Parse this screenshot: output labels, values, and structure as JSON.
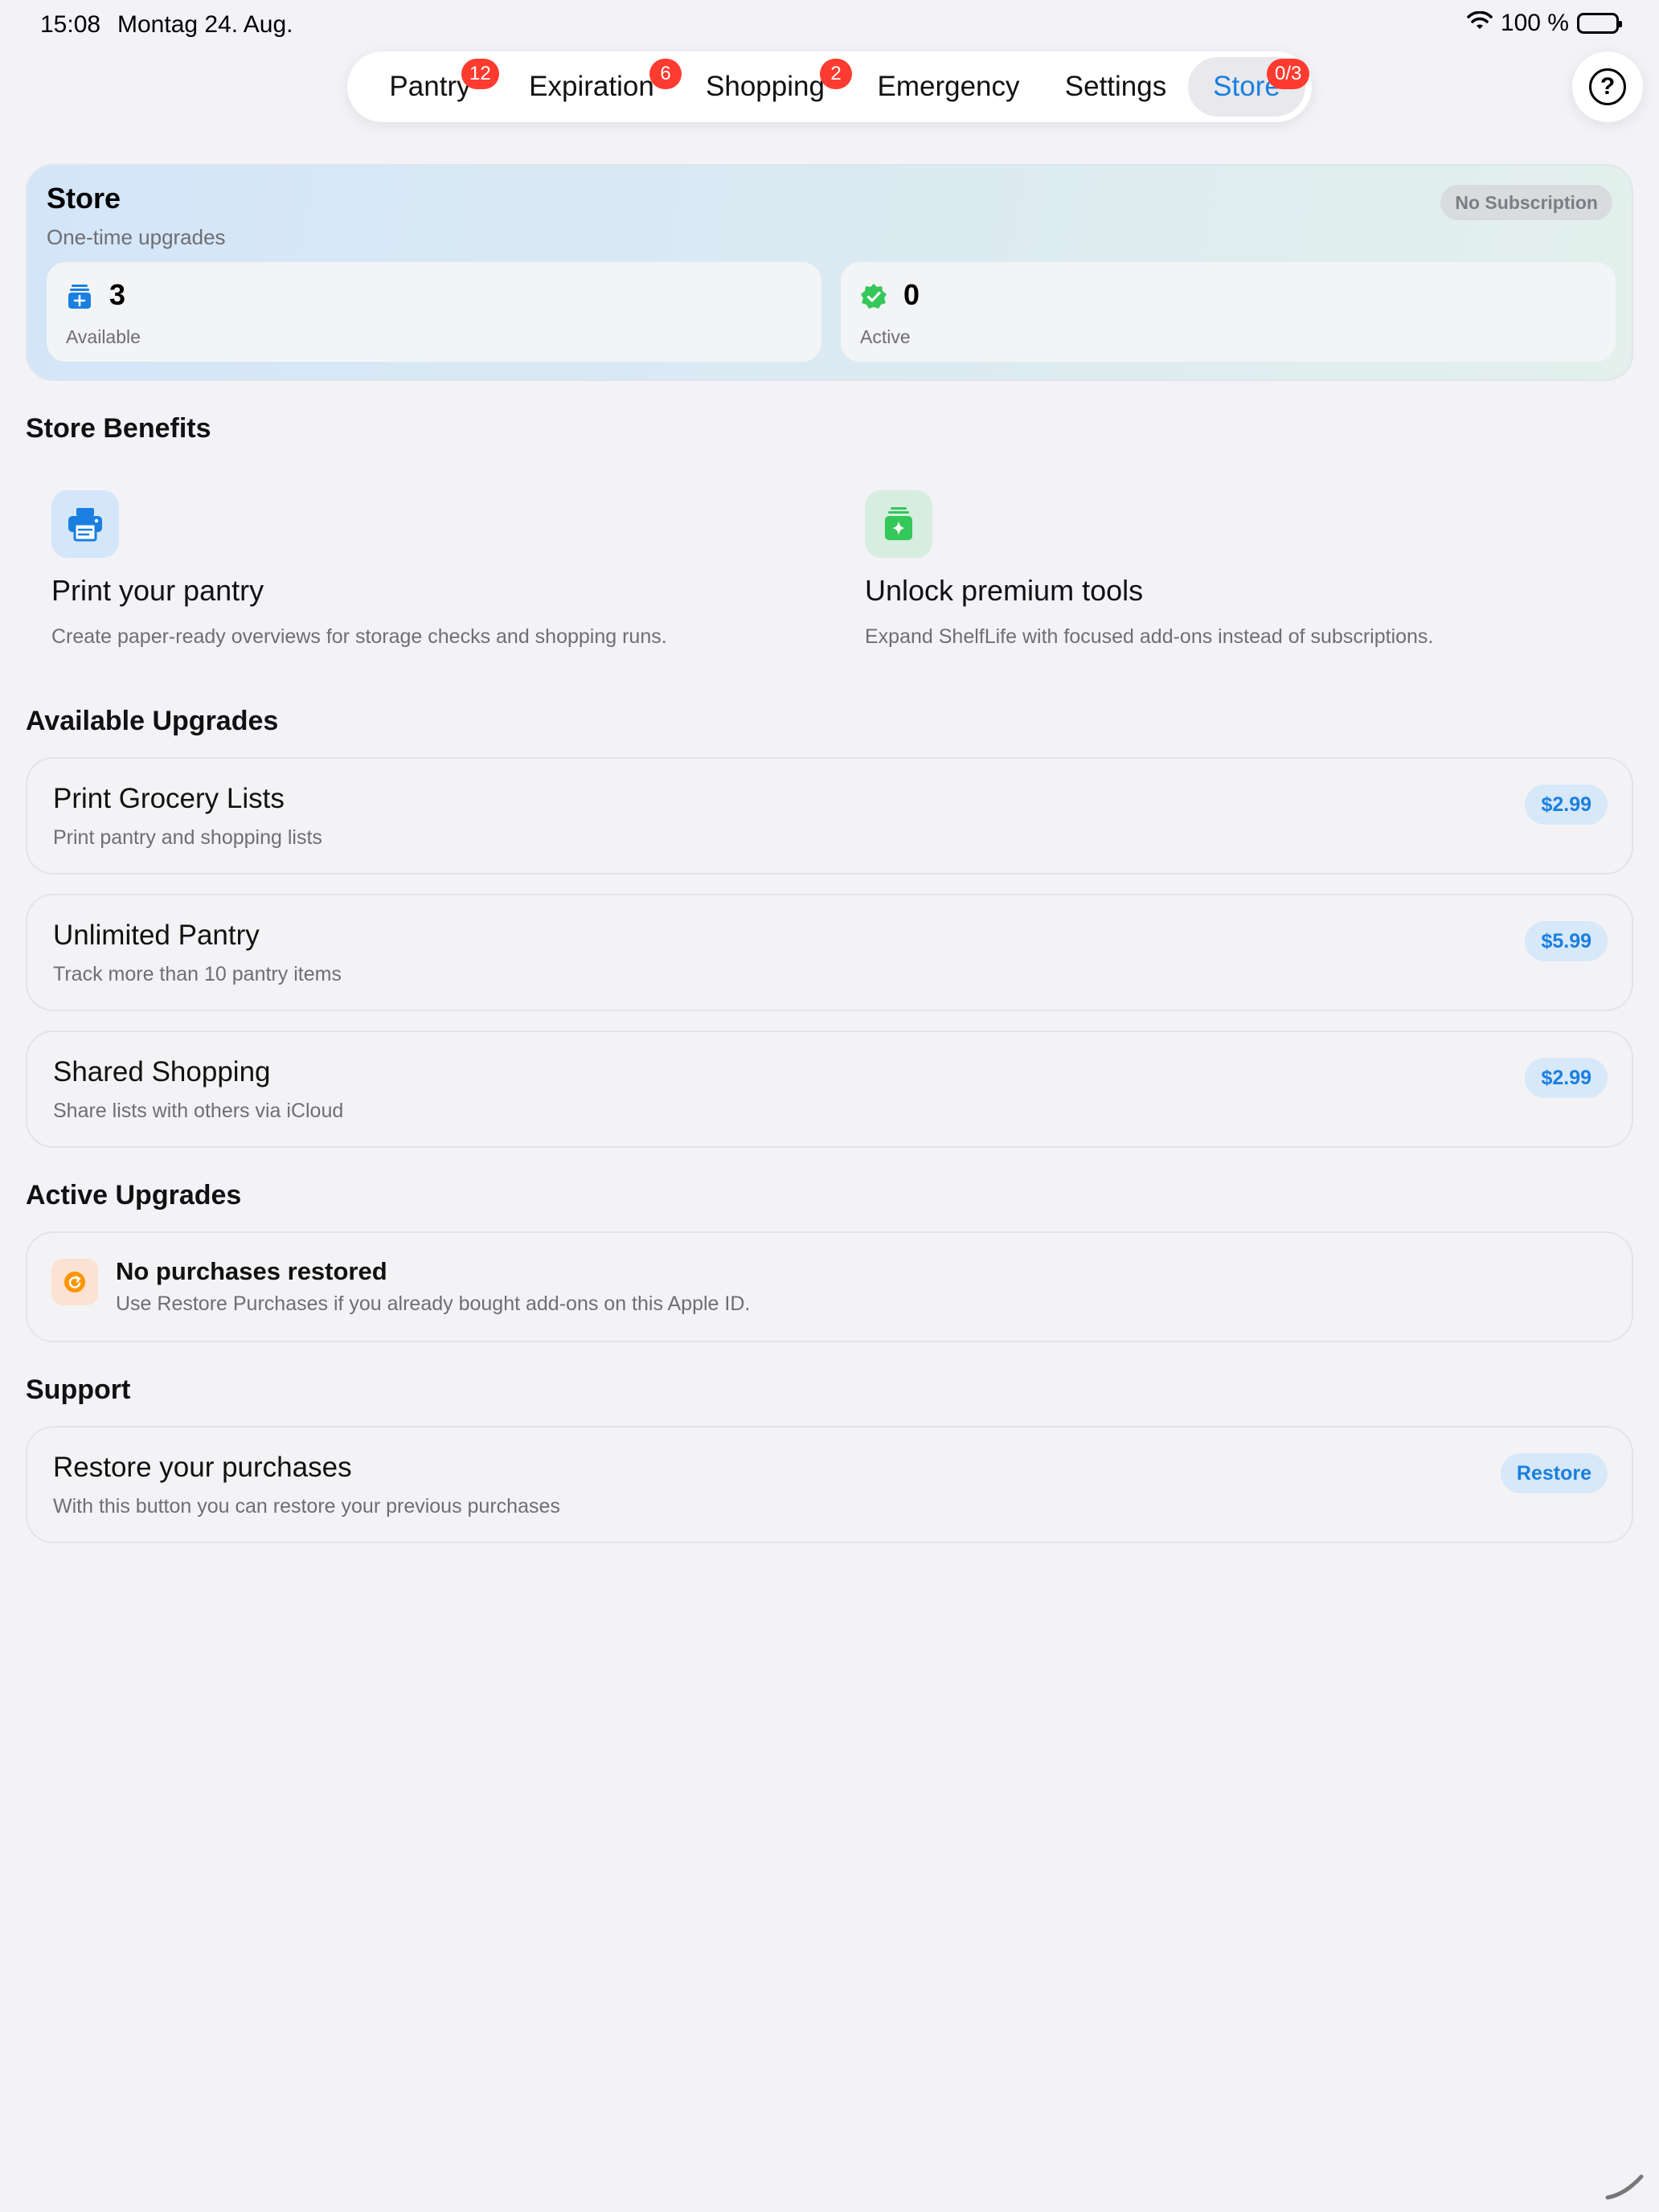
{
  "status_bar": {
    "time": "15:08",
    "date": "Montag 24. Aug.",
    "battery": "100 %"
  },
  "tabs": [
    {
      "label": "Pantry",
      "badge": "12",
      "active": false
    },
    {
      "label": "Expiration",
      "badge": "6",
      "active": false
    },
    {
      "label": "Shopping",
      "badge": "2",
      "active": false
    },
    {
      "label": "Emergency",
      "badge": "",
      "active": false
    },
    {
      "label": "Settings",
      "badge": "",
      "active": false
    },
    {
      "label": "Store",
      "badge": "0/3",
      "active": true
    }
  ],
  "help_icon": "question-circle-icon",
  "header": {
    "title": "Store",
    "subtitle": "One-time upgrades",
    "subscription_badge": "No Subscription",
    "stats": [
      {
        "value": "3",
        "label": "Available",
        "icon": "pantry-plus-icon"
      },
      {
        "value": "0",
        "label": "Active",
        "icon": "checkmark-seal-icon"
      }
    ]
  },
  "benefits": {
    "title": "Store Benefits",
    "items": [
      {
        "title": "Print your pantry",
        "description": "Create paper-ready overviews for storage checks and shopping runs.",
        "icon": "printer-icon"
      },
      {
        "title": "Unlock premium tools",
        "description": "Expand ShelfLife with focused add-ons instead of subscriptions.",
        "icon": "sparkle-stack-icon"
      }
    ]
  },
  "available_upgrades": {
    "title": "Available Upgrades",
    "items": [
      {
        "title": "Print Grocery Lists",
        "subtitle": "Print pantry and shopping lists",
        "price": "$2.99"
      },
      {
        "title": "Unlimited Pantry",
        "subtitle": "Track more than 10 pantry items",
        "price": "$5.99"
      },
      {
        "title": "Shared Shopping",
        "subtitle": "Share lists with others via iCloud",
        "price": "$2.99"
      }
    ]
  },
  "active_upgrades": {
    "title": "Active Upgrades",
    "empty_title": "No purchases restored",
    "empty_subtitle": "Use Restore Purchases if you already bought add-ons on this Apple ID."
  },
  "support": {
    "title": "Support",
    "card_title": "Restore your purchases",
    "card_subtitle": "With this button you can restore your previous purchases",
    "button_label": "Restore"
  },
  "colors": {
    "accent": "#1a7fe0",
    "badge_red": "#ff3b30",
    "green": "#34c759",
    "orange": "#ff9500",
    "background": "#f2f2f7"
  }
}
